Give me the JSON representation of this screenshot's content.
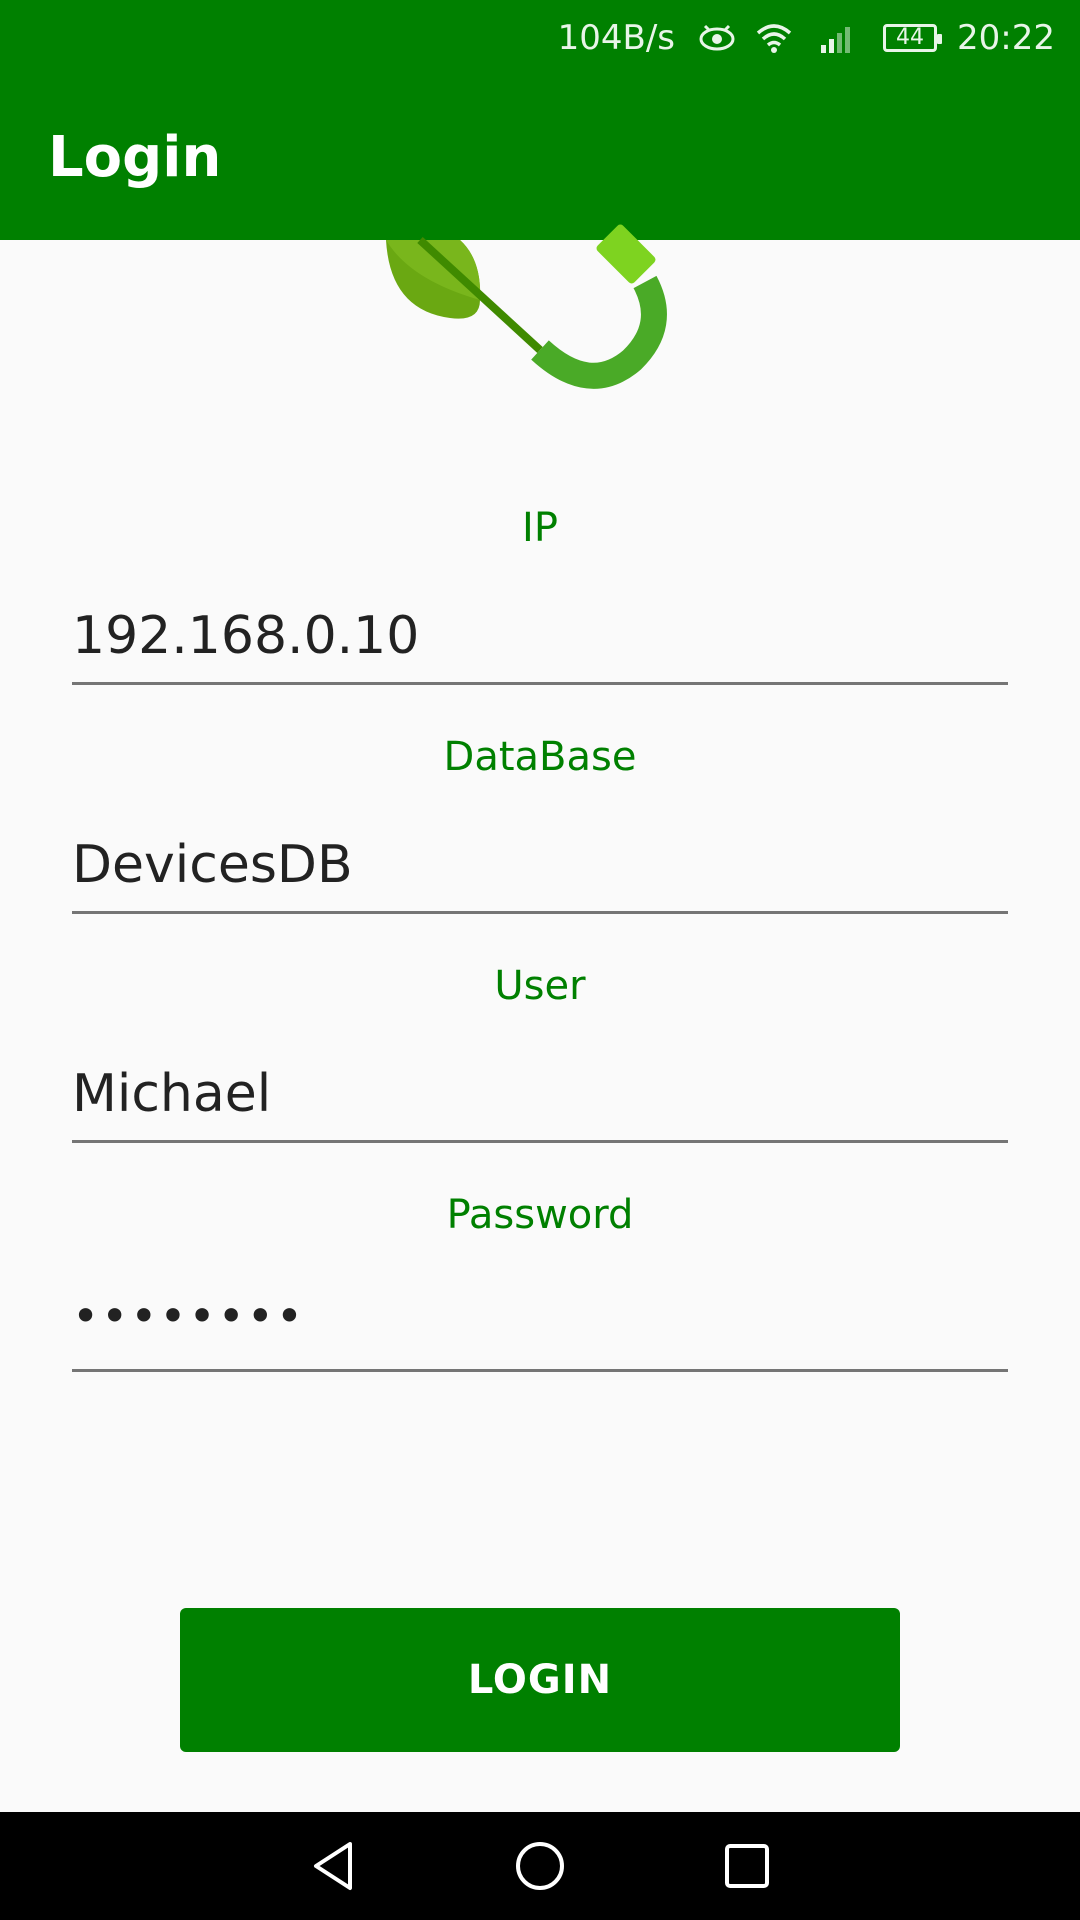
{
  "status_bar": {
    "network_speed": "104B/s",
    "battery": "44",
    "time": "20:22"
  },
  "app_bar": {
    "title": "Login"
  },
  "form": {
    "ip": {
      "label": "IP",
      "value": "192.168.0.10"
    },
    "database": {
      "label": "DataBase",
      "value": "DevicesDB"
    },
    "user": {
      "label": "User",
      "value": "Michael"
    },
    "password": {
      "label": "Password",
      "value": "••••••••"
    }
  },
  "login_button": {
    "label": "LOGIN"
  },
  "icons": {
    "status": [
      "eye-icon",
      "wifi-icon",
      "signal-icon",
      "battery-icon"
    ],
    "nav": [
      "back-icon",
      "home-icon",
      "recents-icon"
    ],
    "logo": "leaf-plug-logo"
  },
  "colors": {
    "primary": "#008000",
    "label": "#008000",
    "background": "#fafafa"
  }
}
